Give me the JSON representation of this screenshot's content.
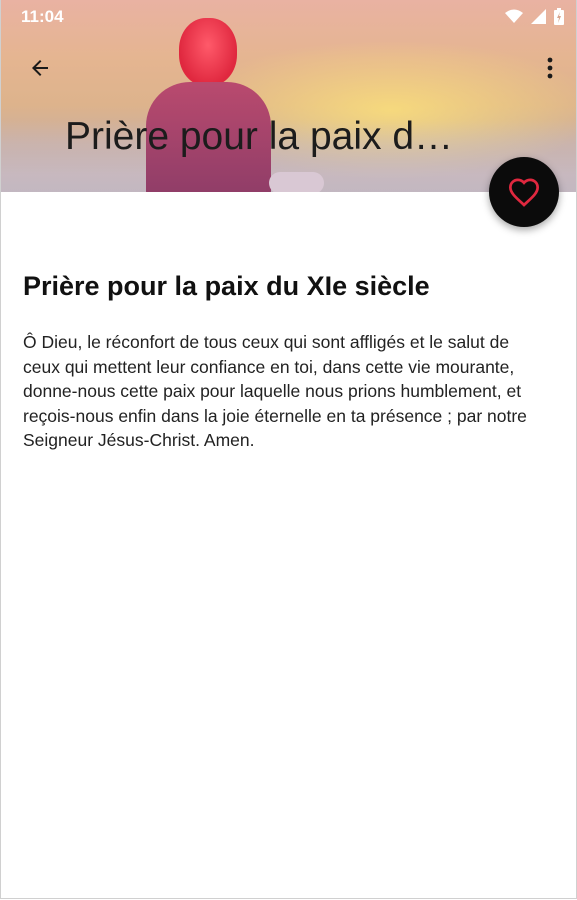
{
  "status_bar": {
    "time": "11:04"
  },
  "toolbar": {
    "title": "Prière pour la paix d…"
  },
  "prayer": {
    "title": "Prière pour la paix du XIe siècle",
    "body": "Ô Dieu, le réconfort de tous ceux qui sont affligés et le salut de ceux qui mettent leur confiance en toi, dans cette vie mourante, donne-nous cette paix pour laquelle nous prions humblement, et reçois-nous enfin dans la joie éternelle en ta présence ; par notre Seigneur Jésus-Christ. Amen."
  },
  "colors": {
    "fab_background": "#0b0b0b",
    "heart": "#e0283f"
  },
  "icons": {
    "back": "arrow-left-icon",
    "menu": "more-vert-icon",
    "favorite": "heart-outline-icon",
    "wifi": "wifi-icon",
    "signal": "signal-icon",
    "battery": "battery-icon"
  }
}
